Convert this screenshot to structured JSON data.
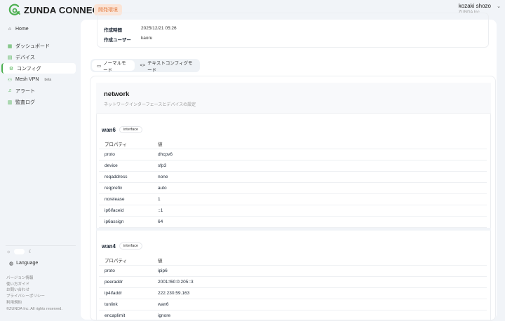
{
  "header": {
    "logo": "ZUNDA CONNECT",
    "env_badge": "開発環境",
    "user_name": "kozaki shozo",
    "user_org": "ZUNDA Inc."
  },
  "sidebar": {
    "home": "Home",
    "items": [
      {
        "label": "ダッシュボード",
        "icon": "grid-icon"
      },
      {
        "label": "デバイス",
        "icon": "server-icon"
      },
      {
        "label": "コンフィグ",
        "icon": "gear-icon"
      },
      {
        "label": "Mesh VPN",
        "icon": "network-icon",
        "badge": "beta"
      },
      {
        "label": "アラート",
        "icon": "bell-icon"
      },
      {
        "label": "監査ログ",
        "icon": "clipboard-icon"
      }
    ],
    "active": 2,
    "language": "Language",
    "links": [
      "バージョン情報",
      "使い方ガイド",
      "お問い合わせ",
      "プライバシーポリシー",
      "利用規約"
    ],
    "copyright": "©ZUNDA Inc. All rights reserved."
  },
  "info": {
    "created_at_label": "作成時間",
    "created_at": "2025/12/21 05:26",
    "created_by_label": "作成ユーザー",
    "created_by": "kaoru"
  },
  "tabs": {
    "normal": "ノーマルモード",
    "text": "テキストコンフィグモード"
  },
  "network": {
    "title": "network",
    "desc": "ネットワークインターフェースとデバイスの設定"
  },
  "table_headers": {
    "prop": "プロパティ",
    "value": "値"
  },
  "sections": [
    {
      "name": "wan6",
      "type": "interface",
      "rows": [
        [
          "proto",
          "dhcpv6"
        ],
        [
          "device",
          "sfp3"
        ],
        [
          "reqaddress",
          "none"
        ],
        [
          "reqprefix",
          "auto"
        ],
        [
          "norelease",
          "1"
        ],
        [
          "ip6ifaceid",
          "::1"
        ],
        [
          "ip6assign",
          "64"
        ]
      ]
    },
    {
      "name": "wan4",
      "type": "interface",
      "rows": [
        [
          "proto",
          "ipip6"
        ],
        [
          "peeraddr",
          "2001:f60:0:205::3"
        ],
        [
          "ip4ifaddr",
          "222.230.59.163"
        ],
        [
          "tunlink",
          "wan6"
        ],
        [
          "encaplimit",
          "ignore"
        ]
      ]
    }
  ],
  "colors": {
    "accent": "#4caf50",
    "env_bg": "#fbe4d6",
    "env_text": "#e3824b"
  }
}
